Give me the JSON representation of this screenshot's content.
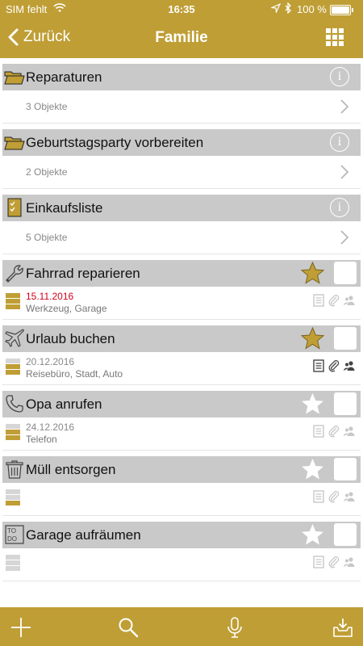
{
  "status_bar": {
    "carrier": "SIM fehlt",
    "time": "16:35",
    "battery": "100 %"
  },
  "nav": {
    "back_label": "Zurück",
    "title": "Familie"
  },
  "colors": {
    "accent": "#bf9e35",
    "header_gray": "#c9c9c9",
    "due_red": "#d0021b",
    "due_gray": "#888888"
  },
  "items": [
    {
      "kind": "folder",
      "icon": "folder-icon",
      "title": "Reparaturen",
      "count": "3 Objekte"
    },
    {
      "kind": "folder",
      "icon": "folder-icon",
      "title": "Geburtstagsparty vorbereiten",
      "count": "2 Objekte"
    },
    {
      "kind": "folder",
      "icon": "checklist-icon",
      "title": "Einkaufsliste",
      "count": "5 Objekte"
    },
    {
      "kind": "task",
      "icon": "wrench-icon",
      "title": "Fahrrad reparieren",
      "starred": true,
      "due": "15.11.2016",
      "due_overdue": true,
      "tags": "Werkzeug, Garage",
      "priority": 2,
      "has_notes": false
    },
    {
      "kind": "task",
      "icon": "airplane-icon",
      "title": "Urlaub buchen",
      "starred": true,
      "due": "20.12.2016",
      "due_overdue": false,
      "tags": "Reisebüro, Stadt, Auto",
      "priority": 1,
      "has_notes": true
    },
    {
      "kind": "task",
      "icon": "phone-icon",
      "title": "Opa anrufen",
      "starred": false,
      "due": "24.12.2016",
      "due_overdue": false,
      "tags": "Telefon",
      "priority": 1,
      "has_notes": false
    },
    {
      "kind": "task",
      "icon": "trash-icon",
      "title": "Müll entsorgen",
      "starred": false,
      "due": "",
      "due_overdue": false,
      "tags": "",
      "priority": 1,
      "has_notes": false
    },
    {
      "kind": "task",
      "icon": "todo-icon",
      "title": "Garage aufräumen",
      "starred": false,
      "due": "",
      "due_overdue": false,
      "tags": "",
      "priority": 0,
      "has_notes": false
    }
  ],
  "toolbar": {
    "items": [
      "add-icon",
      "search-icon",
      "microphone-icon",
      "inbox-download-icon"
    ]
  }
}
